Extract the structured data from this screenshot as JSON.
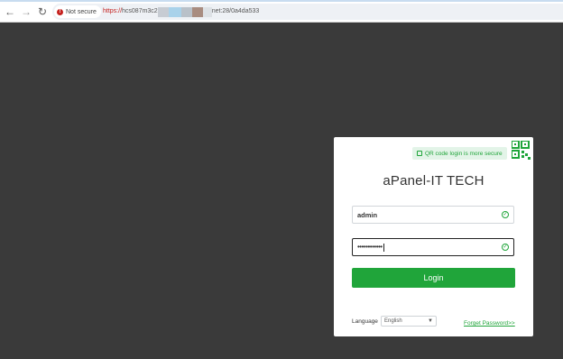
{
  "browser": {
    "security_label": "Not secure",
    "url_scheme": "https://",
    "url_host_start": "hcs087m3c2",
    "url_host_end": "net:28/0a4da533"
  },
  "login": {
    "qr_tip": "QR code login is more secure",
    "title": "aPanel-IT TECH",
    "username_value": "admin",
    "password_value": "••••••••••••",
    "login_label": "Login",
    "language_label": "Language",
    "language_selected": "English",
    "forgot_label": "Forget Password>>"
  },
  "colors": {
    "accent": "#20a53a",
    "background": "#3a3a3a",
    "warning": "#c5221f"
  }
}
